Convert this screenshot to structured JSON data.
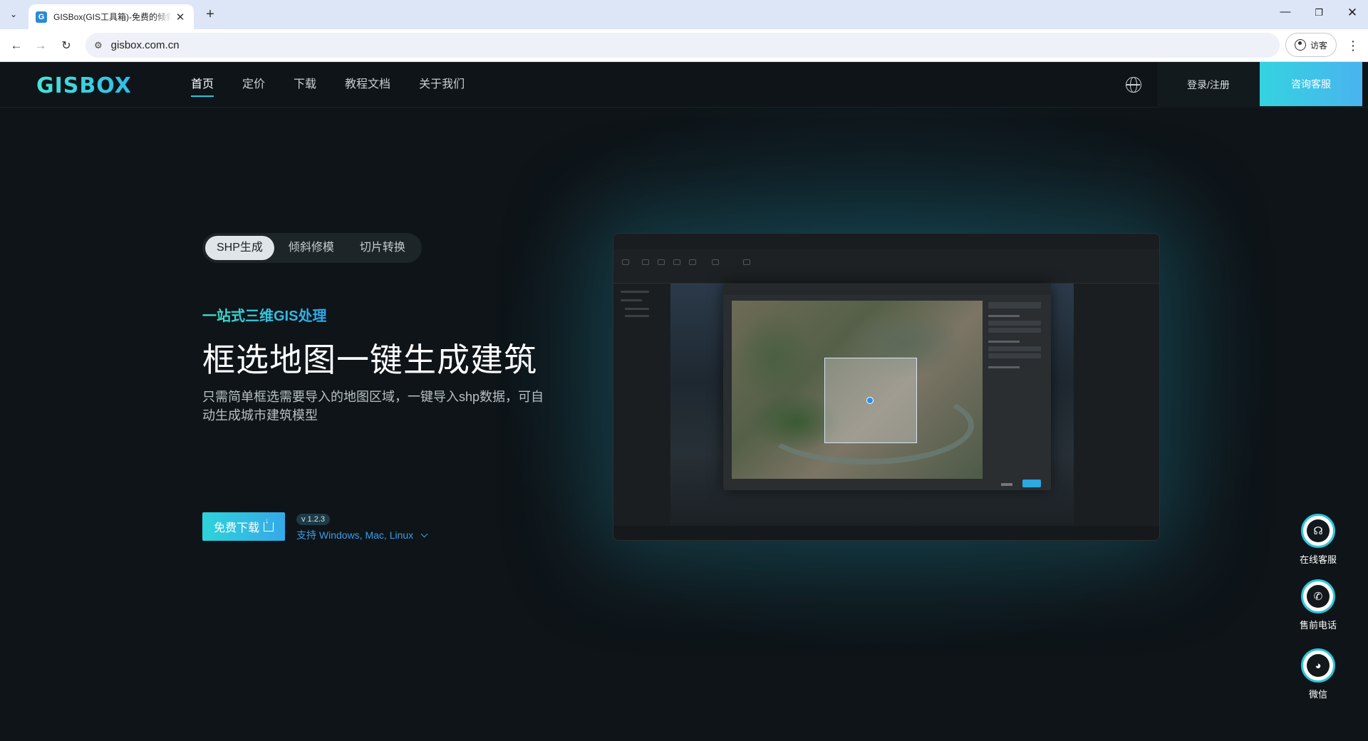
{
  "browser": {
    "tab_title": "GISBox(GIS工具箱)-免费的倾斜",
    "tab_favicon": "G",
    "url": "gisbox.com.cn",
    "guest_label": "访客"
  },
  "header": {
    "logo": "GISBOX",
    "nav": [
      "首页",
      "定价",
      "下载",
      "教程文档",
      "关于我们"
    ],
    "login": "登录/注册",
    "consult": "咨询客服"
  },
  "hero": {
    "feature_tabs": [
      "SHP生成",
      "倾斜修模",
      "切片转换"
    ],
    "subtitle": "一站式三维GIS处理",
    "headline": "框选地图一键生成建筑",
    "description": "只需简单框选需要导入的地图区域，一键导入shp数据，可自动生成城市建筑模型",
    "download_label": "免费下载",
    "version": "v 1.2.3",
    "platforms": "支持 Windows, Mac, Linux"
  },
  "floating": [
    {
      "label": "在线客服",
      "icon": "headset-icon",
      "glyph": "☊"
    },
    {
      "label": "售前电话",
      "icon": "phone-icon",
      "glyph": "✆"
    },
    {
      "label": "微信",
      "icon": "wechat-icon",
      "glyph": "◕"
    }
  ],
  "colors": {
    "accent": "#2ec4dc",
    "background": "#0e1418",
    "link": "#3d9de6"
  }
}
